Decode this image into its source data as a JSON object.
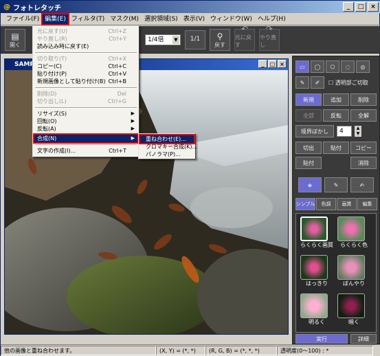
{
  "app": {
    "title": "フォトレタッチ",
    "logo": "@"
  },
  "window_controls": {
    "minimize": "_",
    "maximize": "□",
    "close": "×"
  },
  "menubar": {
    "items": [
      "ファイル(F)",
      "編集(E)",
      "フィルタ(T)",
      "マスク(M)",
      "選択領域(S)",
      "表示(V)",
      "ウィンドウ(W)",
      "ヘルプ(H)"
    ]
  },
  "toolbar": {
    "open_label": "開く",
    "zoom_value": "1/4倍",
    "zoom_one": "1/1",
    "back_label": "戻す",
    "undo_label": "元に戻す",
    "redo_label": "やり直し"
  },
  "document": {
    "title": "SAMPLE"
  },
  "edit_menu": {
    "items": [
      {
        "label": "元に戻す(U)",
        "shortcut": "Ctrl+Z",
        "disabled": true
      },
      {
        "label": "やり直し(R)",
        "shortcut": "Ctrl+Y",
        "disabled": true
      },
      {
        "label": "読み込み時に戻す(E)",
        "shortcut": "",
        "disabled": false
      },
      {
        "label": "切り取り(T)",
        "shortcut": "Ctrl+X",
        "disabled": true
      },
      {
        "label": "コピー(C)",
        "shortcut": "Ctrl+C",
        "disabled": false
      },
      {
        "label": "貼り付け(P)",
        "shortcut": "Ctrl+V",
        "disabled": false
      },
      {
        "label": "新規画像として貼り付け(B)",
        "shortcut": "Ctrl+B",
        "disabled": false
      },
      {
        "label": "削除(D)",
        "shortcut": "Del",
        "disabled": true
      },
      {
        "label": "切り出し(L)",
        "shortcut": "Ctrl+G",
        "disabled": true
      },
      {
        "label": "リサイズ(S)",
        "shortcut": "",
        "disabled": false
      },
      {
        "label": "回転(O)",
        "shortcut": "",
        "disabled": false
      },
      {
        "label": "反転(A)",
        "shortcut": "",
        "disabled": false
      },
      {
        "label": "合成(N)",
        "shortcut": "",
        "disabled": false
      },
      {
        "label": "文字の作成(I)...",
        "shortcut": "Ctrl+T",
        "disabled": false
      }
    ]
  },
  "composite_submenu": {
    "items": [
      "重ね合わせ(E)...",
      "クロマキー合成(K)...",
      "パノラマ(P)..."
    ]
  },
  "right_panel": {
    "transparent_cut": "透明部ご切取",
    "new_label": "新規",
    "add_label": "追加",
    "delete_label": "削除",
    "invert_label": "反転",
    "all_label": "全解",
    "blur_label": "境界ぼかし",
    "blur_value": "4",
    "cut_label": "切出",
    "paste_label": "貼付",
    "copy_label": "コピー",
    "paste2_label": "貼付",
    "erase_label": "消除",
    "tabs": [
      "シンプル",
      "色調",
      "画質",
      "編集"
    ],
    "thumbs": [
      "らくらく画質",
      "らくらく色",
      "はっきり",
      "ぼんやり",
      "明るく",
      "暗く"
    ],
    "run_label": "実行",
    "detail_label": "詳細"
  },
  "status": {
    "message": "他の画像と重ね合わせます。",
    "coords": "(X, Y) = (*, *)",
    "rgb": "(R, G, B) = (*, *, *)",
    "opacity": "透明度(0〜100) : *"
  }
}
